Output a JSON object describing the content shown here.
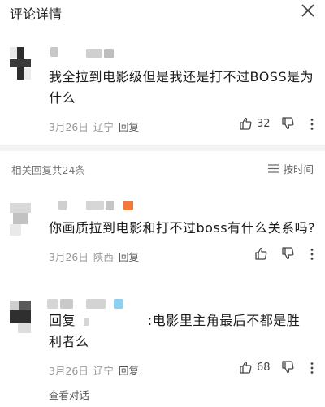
{
  "header": {
    "title": "评论详情"
  },
  "main_comment": {
    "text_line1": "我全拉到电影级但是我还是打不过BOSS是为",
    "text_line2": "什么",
    "date": "3月26日",
    "location": "辽宁",
    "reply_label": "回复",
    "like_count": "32"
  },
  "replies_section": {
    "count_label": "相关回复共24条",
    "sort_label": "按时间"
  },
  "replies": [
    {
      "text_line1": "你画质拉到电影和打不过boss有什么关系吗?",
      "date": "3月26日",
      "location": "陕西",
      "reply_label": "回复"
    },
    {
      "reply_prefix": "回复",
      "text_line1": ":电影里主角最后不都是胜",
      "text_line2": "利者么",
      "date": "3月26日",
      "location": "辽宁",
      "reply_label": "回复",
      "like_count": "68",
      "view_conversation": "查看对话"
    }
  ],
  "colors": {
    "badge_orange": "#f07a3c",
    "badge_blue": "#8ccff0",
    "divider": "#f3f3f3",
    "meta_gray": "#999999"
  },
  "icons": [
    "close-icon",
    "thumbs-up-icon",
    "thumbs-down-icon",
    "more-vertical-icon",
    "sort-lines-icon"
  ]
}
